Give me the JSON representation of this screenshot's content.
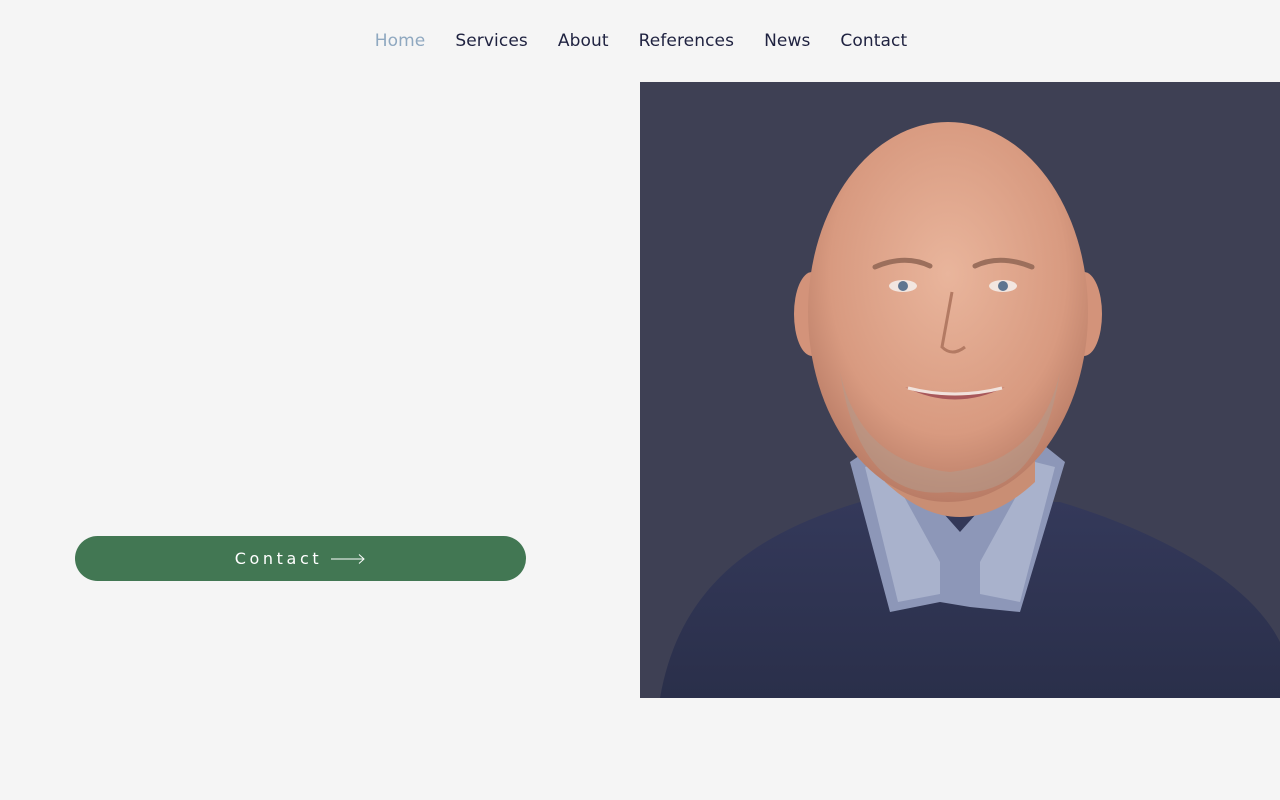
{
  "nav": {
    "items": [
      {
        "label": "Home",
        "active": true
      },
      {
        "label": "Services",
        "active": false
      },
      {
        "label": "About",
        "active": false
      },
      {
        "label": "References",
        "active": false
      },
      {
        "label": "News",
        "active": false
      },
      {
        "label": "Contact",
        "active": false
      }
    ]
  },
  "hero": {
    "button_label": "Contact",
    "button_icon": "arrow-right-icon"
  },
  "portrait": {
    "subject": "portrait-photo"
  },
  "colors": {
    "background": "#f5f5f5",
    "nav_text": "#1f2240",
    "nav_active": "#8fa8c0",
    "button_bg": "#427753",
    "photo_bg": "#3e4054"
  }
}
